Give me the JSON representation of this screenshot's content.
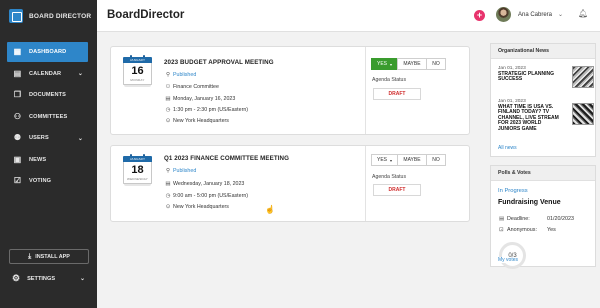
{
  "app": {
    "name": "BOARD DIRECTOR"
  },
  "sidebar": {
    "items": [
      {
        "label": "DASHBOARD",
        "icon": "dashboard-icon"
      },
      {
        "label": "CALENDAR",
        "icon": "calendar-icon"
      },
      {
        "label": "DOCUMENTS",
        "icon": "documents-icon"
      },
      {
        "label": "COMMITTEES",
        "icon": "committees-icon"
      },
      {
        "label": "USERS",
        "icon": "users-icon"
      },
      {
        "label": "NEWS",
        "icon": "news-icon"
      },
      {
        "label": "VOTING",
        "icon": "voting-icon"
      }
    ],
    "install_label": "INSTALL APP",
    "settings_label": "SETTINGS"
  },
  "header": {
    "title": "BoardDirector",
    "user_name": "Ana Cabrera"
  },
  "meetings": [
    {
      "cal_month": "JANUARY",
      "cal_day": "16",
      "cal_weekday": "MONDAY",
      "title": "2023 BUDGET APPROVAL MEETING",
      "status": "Published",
      "committee": "Finance Committee",
      "date": "Monday, January 16, 2023",
      "time": "1:30 pm - 2:30 pm (US/Eastern)",
      "location": "New York Headquarters",
      "vote_yes": "YES",
      "vote_maybe": "MAYBE",
      "vote_no": "NO",
      "agenda_label": "Agenda Status",
      "agenda_status": "DRAFT"
    },
    {
      "cal_month": "JANUARY",
      "cal_day": "18",
      "cal_weekday": "WEDNESDAY",
      "title": "Q1 2023 FINANCE COMMITTEE MEETING",
      "status": "Published",
      "date": "Wednesday, January 18, 2023",
      "time": "9:00 am - 5:00 pm (US/Eastern)",
      "location": "New York Headquarters",
      "vote_yes": "YES",
      "vote_maybe": "MAYBE",
      "vote_no": "NO",
      "agenda_label": "Agenda Status",
      "agenda_status": "DRAFT"
    }
  ],
  "news": {
    "heading": "Organizational News",
    "items": [
      {
        "date": "Jan 01, 2023",
        "title": "STRATEGIC PLANNING SUCCESS"
      },
      {
        "date": "Jan 01, 2023",
        "title": "WHAT TIME IS USA VS. FINLAND TODAY? TV CHANNEL, LIVE STREAM FOR 2023 WORLD JUNIORS GAME"
      }
    ],
    "all_link": "All news"
  },
  "polls": {
    "heading": "Polls & Votes",
    "status": "In Progress",
    "title": "Fundraising Venue",
    "deadline_label": "Deadline:",
    "deadline_value": "01/20/2023",
    "anonymous_label": "Anonymous:",
    "anonymous_value": "Yes",
    "progress": "0/3",
    "link": "My votes"
  },
  "colors": {
    "accent": "#2e86c9",
    "sidebar_bg": "#2b2b2b",
    "yes_selected": "#3a9c2e",
    "draft": "#d02d2d",
    "add_button": "#e8336c"
  }
}
